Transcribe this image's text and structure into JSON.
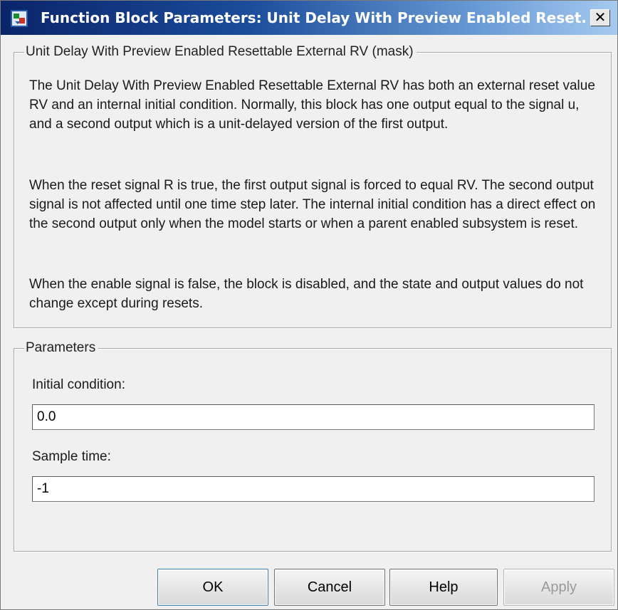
{
  "window": {
    "title": "Function Block Parameters: Unit Delay With Preview Enabled Reset..."
  },
  "mask": {
    "legend": "Unit Delay With Preview Enabled Resettable External RV (mask)",
    "paragraphs": [
      "The Unit Delay With Preview Enabled Resettable External RV has both an external reset value RV and an internal initial condition. Normally, this block has one output equal to the signal u, and a second output which is a unit-delayed version of the first output.",
      "When the reset signal R is true, the first output signal is forced to equal RV. The second output signal is not affected until one time step later. The internal initial condition has a direct effect on the second output only when the model starts or when a parent enabled subsystem is reset.",
      "When the enable signal is false, the block is disabled, and the state and output values do not change except during resets."
    ]
  },
  "parameters": {
    "legend": "Parameters",
    "initial_condition_label": "Initial condition:",
    "initial_condition_value": "0.0",
    "sample_time_label": "Sample time:",
    "sample_time_value": "-1"
  },
  "buttons": {
    "ok": "OK",
    "cancel": "Cancel",
    "help": "Help",
    "apply": "Apply"
  },
  "icons": {
    "title": "simulink-block-icon",
    "close": "close-icon"
  }
}
